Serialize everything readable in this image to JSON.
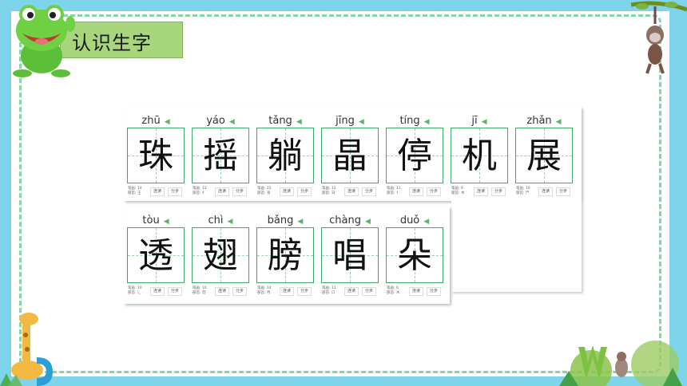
{
  "title": "认识生字",
  "row1": [
    {
      "pinyin": "zhū",
      "hanzi": "珠",
      "strokes": "笔画: 10",
      "radical": "部首: 王",
      "read_label": "连读",
      "step_label": "分步"
    },
    {
      "pinyin": "yáo",
      "hanzi": "摇",
      "strokes": "笔画: 13",
      "radical": "部首: 扌",
      "read_label": "连读",
      "step_label": "分步"
    },
    {
      "pinyin": "tǎng",
      "hanzi": "躺",
      "strokes": "笔画: 15",
      "radical": "部首: 身",
      "read_label": "连读",
      "step_label": "分步"
    },
    {
      "pinyin": "jīng",
      "hanzi": "晶",
      "strokes": "笔画: 12",
      "radical": "部首: 日",
      "read_label": "连读",
      "step_label": "分步"
    },
    {
      "pinyin": "tíng",
      "hanzi": "停",
      "strokes": "笔画: 11",
      "radical": "部首: 亻",
      "read_label": "连读",
      "step_label": "分步"
    },
    {
      "pinyin": "jī",
      "hanzi": "机",
      "strokes": "笔画: 6",
      "radical": "部首: 木",
      "read_label": "连读",
      "step_label": "分步"
    },
    {
      "pinyin": "zhǎn",
      "hanzi": "展",
      "strokes": "笔画: 10",
      "radical": "部首: 尸",
      "read_label": "连读",
      "step_label": "分步"
    }
  ],
  "row2": [
    {
      "pinyin": "tòu",
      "hanzi": "透",
      "strokes": "笔画: 10",
      "radical": "部首: 辶",
      "read_label": "连读",
      "step_label": "分步"
    },
    {
      "pinyin": "chì",
      "hanzi": "翅",
      "strokes": "笔画: 10",
      "radical": "部首: 羽",
      "read_label": "连读",
      "step_label": "分步"
    },
    {
      "pinyin": "bǎng",
      "hanzi": "膀",
      "strokes": "笔画: 14",
      "radical": "部首: 月",
      "read_label": "连读",
      "step_label": "分步"
    },
    {
      "pinyin": "chàng",
      "hanzi": "唱",
      "strokes": "笔画: 11",
      "radical": "部首: 口",
      "read_label": "连读",
      "step_label": "分步"
    },
    {
      "pinyin": "duǒ",
      "hanzi": "朵",
      "strokes": "笔画: 6",
      "radical": "部首: 木",
      "read_label": "连读",
      "step_label": "分步"
    }
  ],
  "icons": {
    "speaker": "speaker-icon"
  },
  "colors": {
    "frame": "#7ed4ea",
    "title_bg": "#a7d67d",
    "grid": "#3daa6a"
  }
}
